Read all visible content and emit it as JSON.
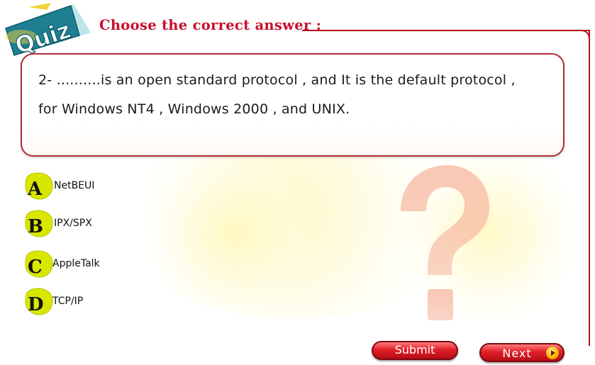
{
  "header": {
    "badge_text": "Quiz",
    "title": "Choose the correct answer :"
  },
  "question": {
    "line1": "2- ..........is an open standard protocol , and It is the default protocol ,",
    "line2": "for Windows NT4 , Windows 2000 , and UNIX."
  },
  "answers": [
    {
      "letter": "A",
      "label": "NetBEUI"
    },
    {
      "letter": "B",
      "label": "IPX/SPX"
    },
    {
      "letter": "C",
      "label": "AppleTalk"
    },
    {
      "letter": "D",
      "label": "TCP/IP"
    }
  ],
  "buttons": {
    "submit": "Submit",
    "next": "Next"
  },
  "colors": {
    "accent": "#c8102e",
    "badge_teal": "#2a8fa0",
    "answer_icon": "#d8e600"
  },
  "icons": {
    "background": "question-mark-icon",
    "next": "play-arrow-icon"
  }
}
